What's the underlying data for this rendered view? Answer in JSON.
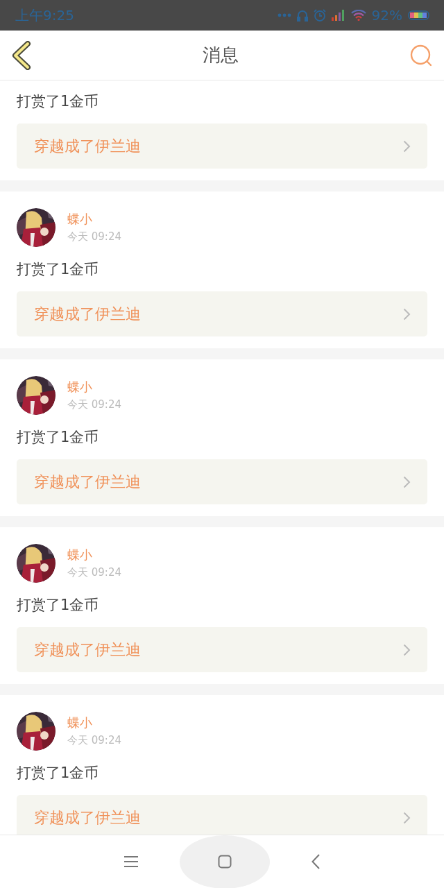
{
  "status_bar": {
    "time": "上午9:25",
    "battery": "92%"
  },
  "header": {
    "title": "消息"
  },
  "messages": [
    {
      "text": "打赏了1金币",
      "link": "穿越成了伊兰迪"
    },
    {
      "user": "蝶小",
      "time": "今天 09:24",
      "text": "打赏了1金币",
      "link": "穿越成了伊兰迪"
    },
    {
      "user": "蝶小",
      "time": "今天 09:24",
      "text": "打赏了1金币",
      "link": "穿越成了伊兰迪"
    },
    {
      "user": "蝶小",
      "time": "今天 09:24",
      "text": "打赏了1金币",
      "link": "穿越成了伊兰迪"
    },
    {
      "user": "蝶小",
      "time": "今天 09:24",
      "text": "打赏了1金币",
      "link": "穿越成了伊兰迪"
    }
  ]
}
